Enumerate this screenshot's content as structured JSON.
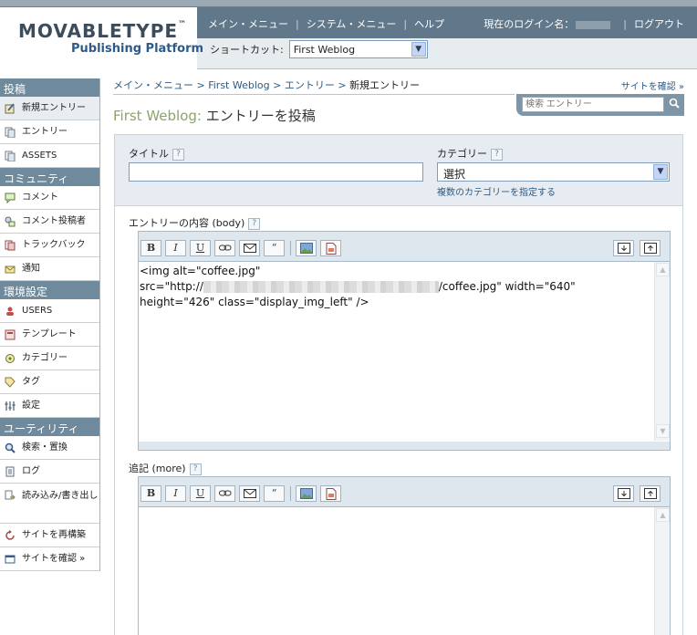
{
  "brand": {
    "name": "MOVABLETYPE",
    "tm": "™",
    "subtitle": "Publishing Platform"
  },
  "topnav": {
    "main_menu": "メイン・メニュー",
    "system_menu": "システム・メニュー",
    "help": "ヘルプ",
    "sep": "|"
  },
  "login": {
    "label": "現在のログイン名：",
    "logout": "ログアウト"
  },
  "shortcut": {
    "label": "ショートカット:",
    "value": "First Weblog"
  },
  "sidebar": {
    "sections": [
      {
        "title": "投稿"
      },
      {
        "title": "コミュニティ"
      },
      {
        "title": "環境設定"
      },
      {
        "title": "ユーティリティ"
      }
    ],
    "items": [
      {
        "label": "新規エントリー",
        "icon": "new-entry-icon"
      },
      {
        "label": "エントリー",
        "icon": "entries-icon"
      },
      {
        "label": "ASSETS",
        "icon": "assets-icon"
      },
      {
        "label": "コメント",
        "icon": "comment-icon"
      },
      {
        "label": "コメント投稿者",
        "icon": "commenter-icon"
      },
      {
        "label": "トラックバック",
        "icon": "trackback-icon"
      },
      {
        "label": "通知",
        "icon": "notification-icon"
      },
      {
        "label": "USERS",
        "icon": "users-icon"
      },
      {
        "label": "テンプレート",
        "icon": "template-icon"
      },
      {
        "label": "カテゴリー",
        "icon": "category-icon"
      },
      {
        "label": "タグ",
        "icon": "tag-icon"
      },
      {
        "label": "設定",
        "icon": "settings-icon"
      },
      {
        "label": "検索・置換",
        "icon": "search-replace-icon"
      },
      {
        "label": "ログ",
        "icon": "log-icon"
      },
      {
        "label": "読み込み/書き出し",
        "icon": "import-export-icon"
      },
      {
        "label": "サイトを再構築",
        "icon": "rebuild-icon"
      },
      {
        "label": "サイトを確認 »",
        "icon": "view-site-icon"
      }
    ]
  },
  "breadcrumb": {
    "main": "メイン・メニュー",
    "blog": "First Weblog",
    "entries": "エントリー",
    "current": "新規エントリー",
    "sep": ">"
  },
  "view_site": "サイトを確認 »",
  "search": {
    "placeholder": "検索 エントリー"
  },
  "page_title": {
    "blog": "First Weblog:",
    "action": "エントリーを投稿"
  },
  "form": {
    "title_label": "タイトル",
    "category_label": "カテゴリー",
    "category_value": "選択",
    "multi_category_link": "複数のカテゴリーを指定する",
    "body_label": "エントリーの内容 (body)",
    "more_label": "追記 (more)",
    "help": "?"
  },
  "toolbar": {
    "bold": "B",
    "italic": "I",
    "underline": "U",
    "quote": "“"
  },
  "body_text": {
    "line1": "<img alt=\"coffee.jpg\"",
    "line2_start": "src=\"http://",
    "line2_end": "/coffee.jpg\" width=\"640\"",
    "line3": "height=\"426\" class=\"display_img_left\" />"
  }
}
